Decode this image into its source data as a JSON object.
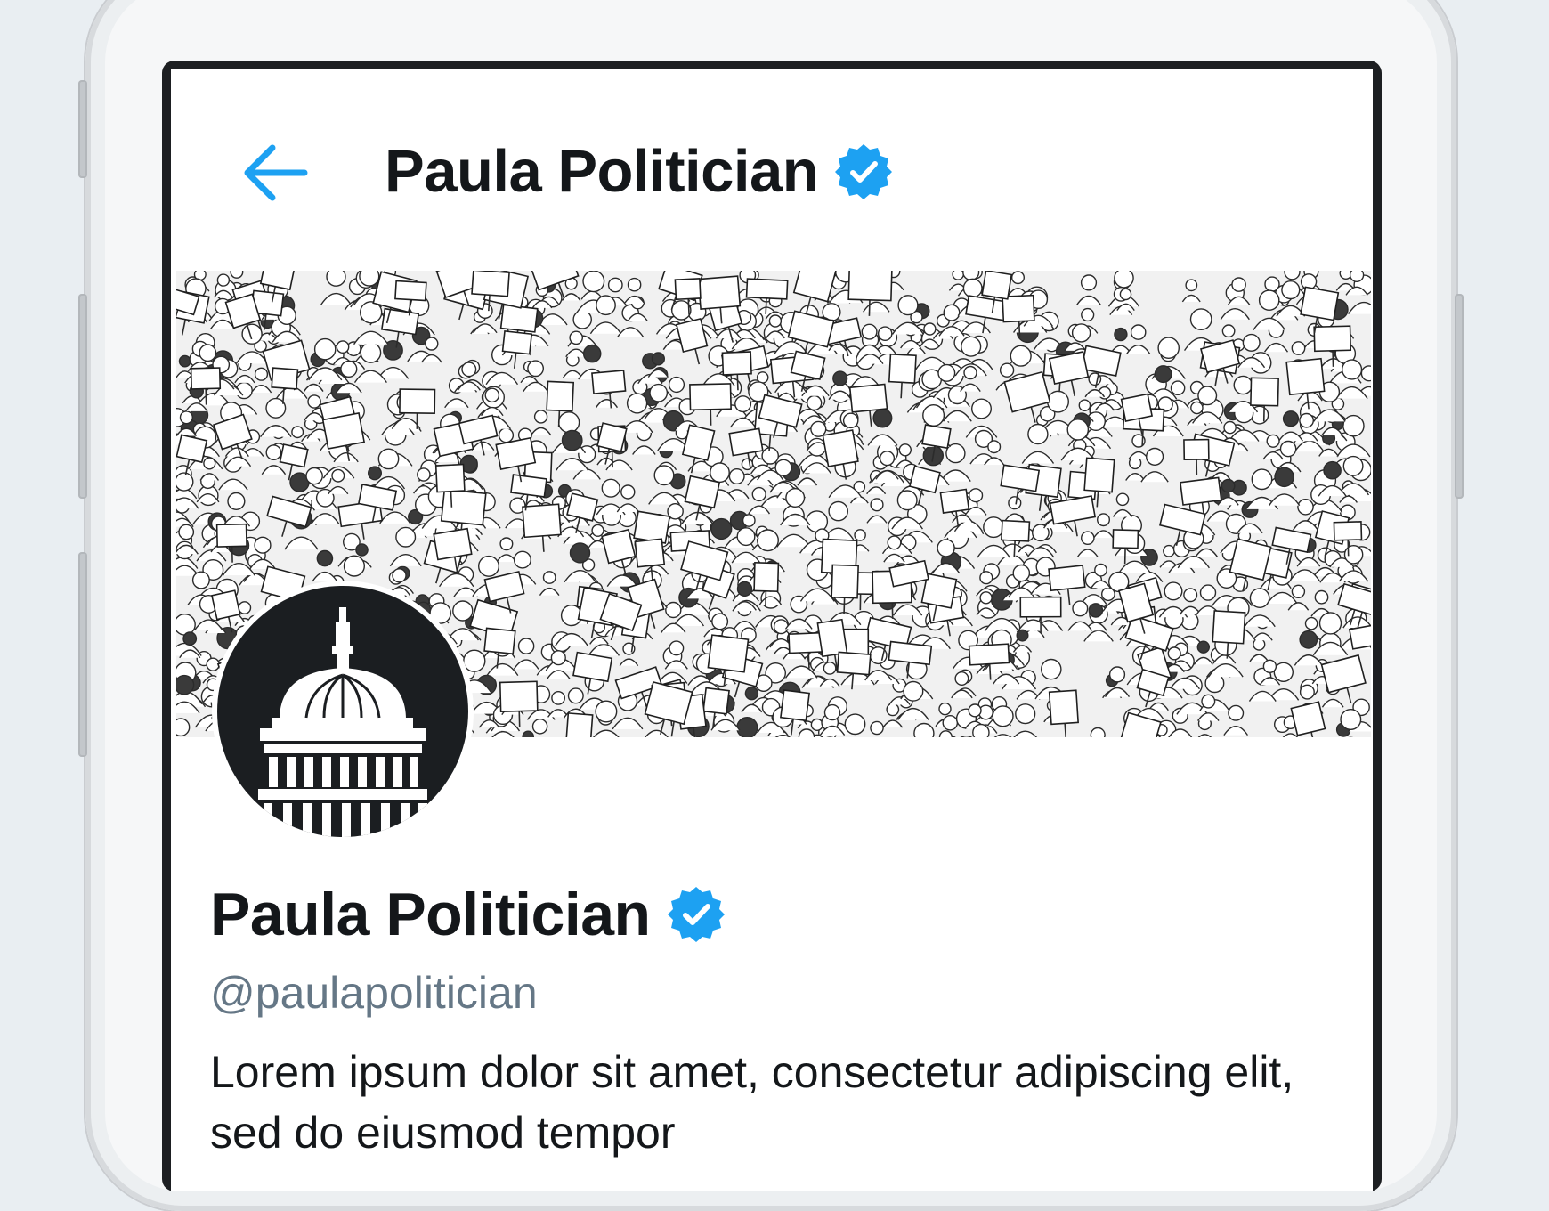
{
  "header": {
    "back_icon": "arrow-left-icon",
    "title": "Paula Politician",
    "verified_icon": "verified-badge-icon"
  },
  "banner": {
    "image": "crowd-protest-illustration"
  },
  "profile": {
    "avatar_icon": "capitol-dome-icon",
    "name": "Paula Politician",
    "verified_icon": "verified-badge-icon",
    "handle": "@paulapolitician",
    "bio": "Lorem ipsum dolor sit amet, consectetur adipiscing elit, sed do eiusmod tempor"
  },
  "colors": {
    "accent": "#1da1f2",
    "text": "#14171a",
    "secondary_text": "#657786"
  }
}
